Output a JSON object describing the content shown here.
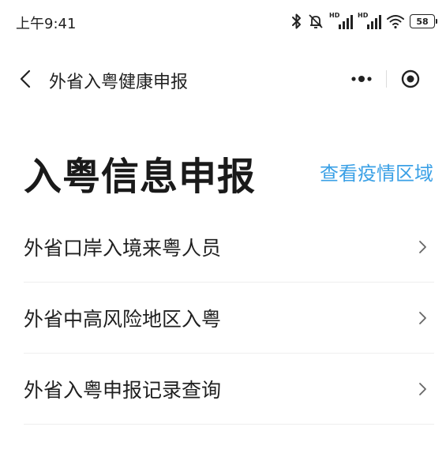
{
  "status_bar": {
    "time": "上午9:41",
    "hd_label_1": "HD",
    "hd_label_2": "HD",
    "battery": "58",
    "icons": [
      "bluetooth-icon",
      "alarm-off-icon",
      "signal-hd-icon",
      "signal-hd-icon",
      "wifi-icon",
      "battery-icon"
    ]
  },
  "nav": {
    "title": "外省入粤健康申报",
    "back_icon": "chevron-left-icon",
    "more_icon": "more-dots-icon",
    "close_icon": "target-icon"
  },
  "heading": {
    "title": "入粤信息申报",
    "link": "查看疫情区域"
  },
  "menu": {
    "items": [
      {
        "label": "外省口岸入境来粤人员"
      },
      {
        "label": "外省中高风险地区入粤"
      },
      {
        "label": "外省入粤申报记录查询"
      }
    ]
  },
  "colors": {
    "link": "#3aa0e6",
    "text": "#1f1f1f",
    "divider": "#eeeeee"
  }
}
